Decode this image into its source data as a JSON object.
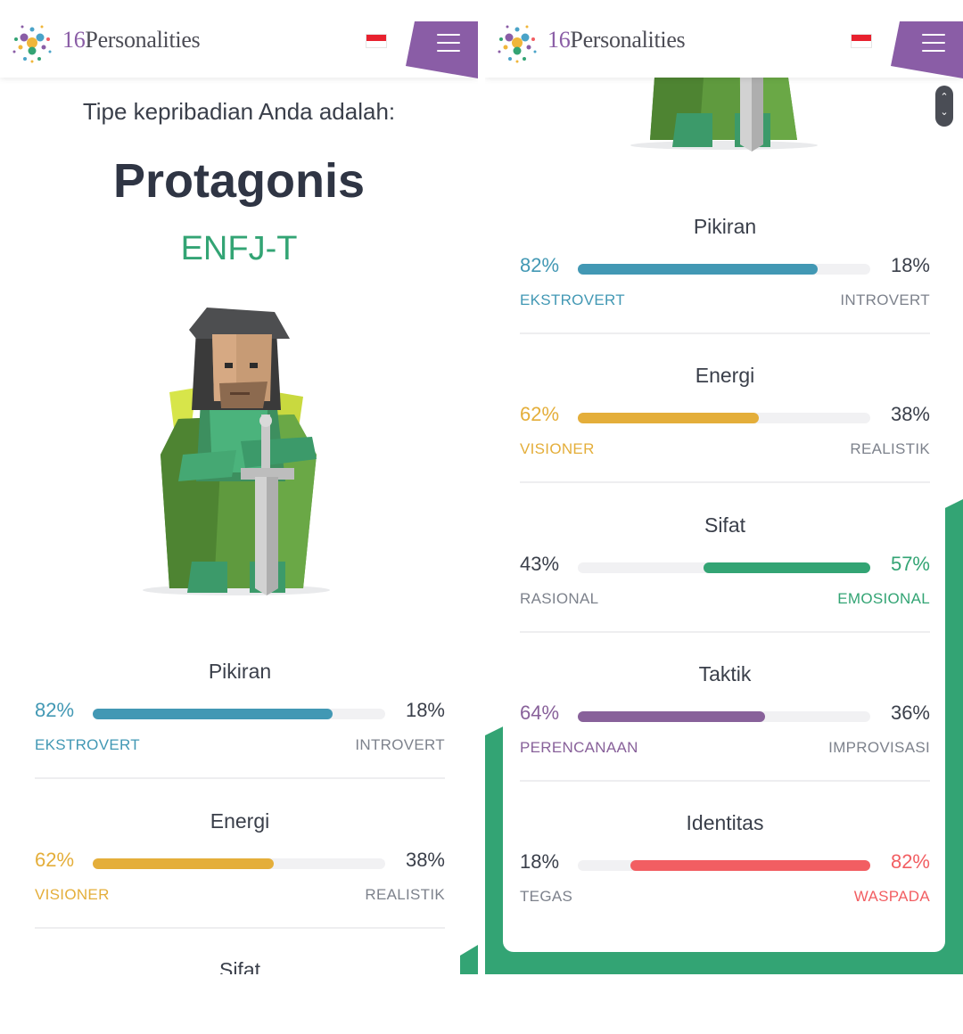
{
  "header": {
    "logo_num": "16",
    "logo_word": "Personalities",
    "flag": "id-flag",
    "menu": "menu-icon"
  },
  "left": {
    "intro": "Tipe kepribadian Anda adalah:",
    "type_name": "Protagonis",
    "type_code": "ENFJ-T",
    "traits": [
      {
        "title": "Pikiran",
        "left_pct": "82%",
        "right_pct": "18%",
        "left_label": "EKSTROVERT",
        "right_label": "INTROVERT"
      },
      {
        "title": "Energi",
        "left_pct": "62%",
        "right_pct": "38%",
        "left_label": "VISIONER",
        "right_label": "REALISTIK"
      },
      {
        "title": "Sifat"
      }
    ]
  },
  "right": {
    "traits": [
      {
        "title": "Pikiran",
        "left_pct": "82%",
        "right_pct": "18%",
        "left_label": "EKSTROVERT",
        "right_label": "INTROVERT"
      },
      {
        "title": "Energi",
        "left_pct": "62%",
        "right_pct": "38%",
        "left_label": "VISIONER",
        "right_label": "REALISTIK"
      },
      {
        "title": "Sifat",
        "left_pct": "43%",
        "right_pct": "57%",
        "left_label": "RASIONAL",
        "right_label": "EMOSIONAL"
      },
      {
        "title": "Taktik",
        "left_pct": "64%",
        "right_pct": "36%",
        "left_label": "PERENCANAAN",
        "right_label": "IMPROVISASI"
      },
      {
        "title": "Identitas",
        "left_pct": "18%",
        "right_pct": "82%",
        "left_label": "TEGAS",
        "right_label": "WASPADA"
      }
    ]
  },
  "colors": {
    "blue": "#4298b4",
    "yellow": "#e4ae3a",
    "green": "#33a474",
    "purple": "#88619a",
    "red": "#f25e62",
    "brand_purple": "#8a5da6"
  }
}
